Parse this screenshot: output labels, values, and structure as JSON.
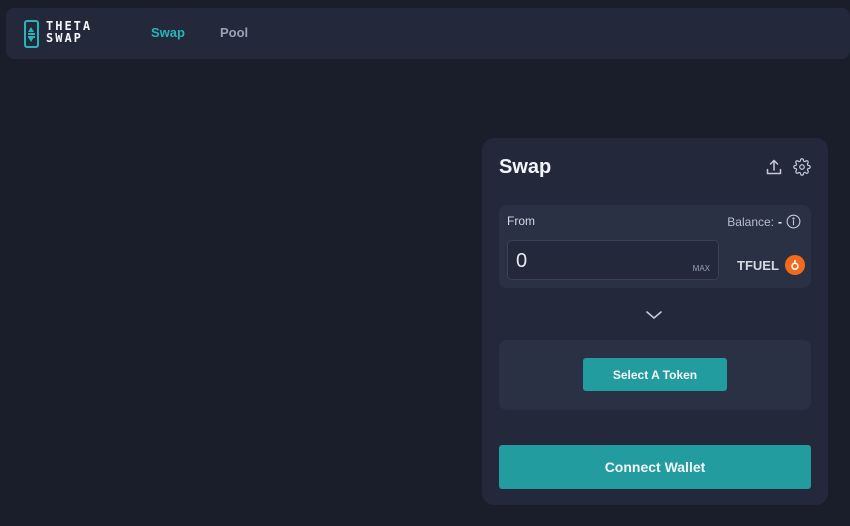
{
  "brand": {
    "logo_line1": "THETA",
    "logo_line2": "SWAP",
    "accent_color": "#27b5b9",
    "button_color": "#239c9f"
  },
  "nav": {
    "items": [
      {
        "label": "Swap",
        "active": true
      },
      {
        "label": "Pool",
        "active": false
      }
    ]
  },
  "swap_card": {
    "title": "Swap",
    "header_icons": [
      "upload-icon",
      "gear-icon"
    ],
    "from": {
      "label": "From",
      "balance_label": "Balance:",
      "balance_value": "-",
      "amount_value": "0",
      "max_label": "MAX",
      "token_name": "TFUEL",
      "token_color": "#f26b1d"
    },
    "to": {
      "select_token_label": "Select A Token"
    },
    "connect_wallet_label": "Connect Wallet"
  }
}
